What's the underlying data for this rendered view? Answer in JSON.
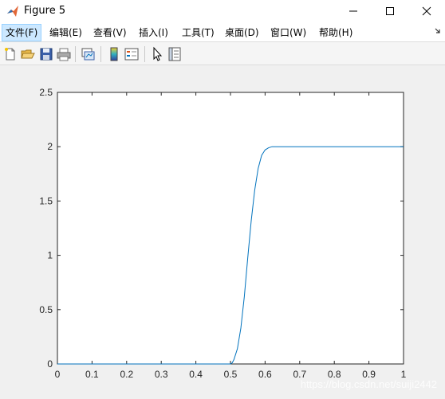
{
  "window": {
    "title": "Figure 5"
  },
  "menu": [
    {
      "label": "文件(F)",
      "active": true
    },
    {
      "label": "编辑(E)",
      "active": false
    },
    {
      "label": "查看(V)",
      "active": false
    },
    {
      "label": "插入(I)",
      "active": false
    },
    {
      "label": "工具(T)",
      "active": false
    },
    {
      "label": "桌面(D)",
      "active": false
    },
    {
      "label": "窗口(W)",
      "active": false
    },
    {
      "label": "帮助(H)",
      "active": false
    }
  ],
  "toolbar": {
    "icons": [
      "new-figure-icon",
      "open-file-icon",
      "save-icon",
      "print-icon",
      "link-plot-icon",
      "colorbar-icon",
      "legend-icon",
      "pointer-icon",
      "property-editor-icon"
    ]
  },
  "colors": {
    "line": "#0072bd",
    "axes_bg": "#ffffff",
    "figure_bg": "#f0f0f0",
    "menu_highlight": "#cce8ff"
  },
  "chart_data": {
    "type": "line",
    "xlim": [
      0,
      1
    ],
    "ylim": [
      0,
      2.5
    ],
    "xticks": [
      0,
      0.1,
      0.2,
      0.3,
      0.4,
      0.5,
      0.6,
      0.7,
      0.8,
      0.9,
      1
    ],
    "xtick_labels": [
      "0",
      "0.1",
      "0.2",
      "0.3",
      "0.4",
      "0.5",
      "0.6",
      "0.7",
      "0.8",
      "0.9",
      "1"
    ],
    "yticks": [
      0,
      0.5,
      1,
      1.5,
      2,
      2.5
    ],
    "ytick_labels": [
      "0",
      "0.5",
      "1",
      "1.5",
      "2",
      "2.5"
    ],
    "grid": false,
    "series": [
      {
        "x": [
          0,
          0.1,
          0.2,
          0.3,
          0.4,
          0.5,
          0.505,
          0.51,
          0.52,
          0.53,
          0.54,
          0.55,
          0.56,
          0.57,
          0.58,
          0.59,
          0.6,
          0.61,
          0.62,
          0.63,
          0.65,
          0.7,
          0.8,
          0.9,
          1
        ],
        "y": [
          0,
          0,
          0,
          0,
          0,
          0,
          0.01,
          0.04,
          0.14,
          0.33,
          0.62,
          0.98,
          1.32,
          1.6,
          1.8,
          1.92,
          1.97,
          1.99,
          2.0,
          2.0,
          2.0,
          2.0,
          2.0,
          2.0,
          2.0
        ]
      }
    ]
  },
  "watermark": "https://blog.csdn.net/suiji2442"
}
